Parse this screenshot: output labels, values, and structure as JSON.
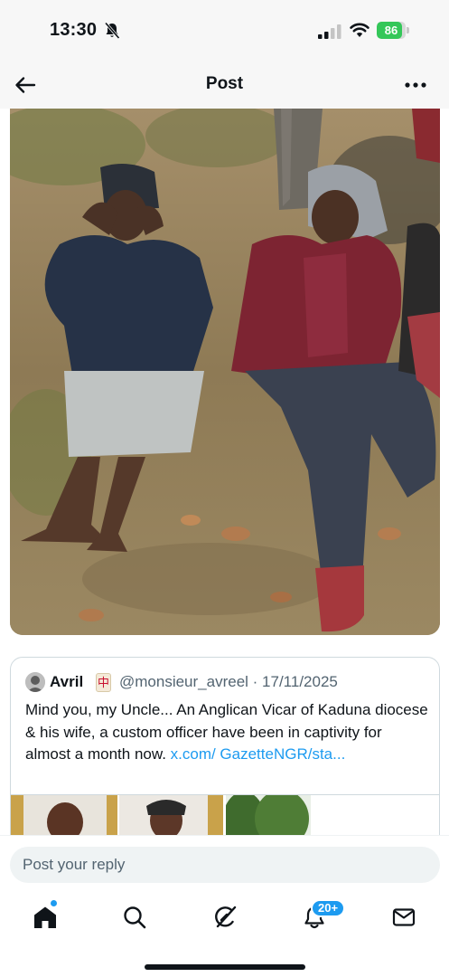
{
  "status_bar": {
    "time": "13:30",
    "battery": "86",
    "battery_level": 0.86
  },
  "header": {
    "title": "Post"
  },
  "quoted_post": {
    "author_name": "Avril",
    "badge_glyph": "中",
    "meta": "@monsieur_avreel · 17/11/2025",
    "text": "Mind you, my Uncle... An Anglican Vicar of Kaduna diocese & his wife, a custom officer have been in captivity for almost a month now. ",
    "link": "x.com/ GazetteNGR/sta..."
  },
  "reply": {
    "placeholder": "Post your reply"
  },
  "tab_bar": {
    "notifications_badge": "20+"
  },
  "colors": {
    "accent": "#1d9bf0",
    "battery_green": "#34c759"
  },
  "icons": [
    "bell-slash-icon",
    "signal-icon",
    "wifi-icon",
    "back-arrow-icon",
    "more-icon",
    "home-icon",
    "search-icon",
    "grok-icon",
    "notifications-icon",
    "messages-icon"
  ]
}
